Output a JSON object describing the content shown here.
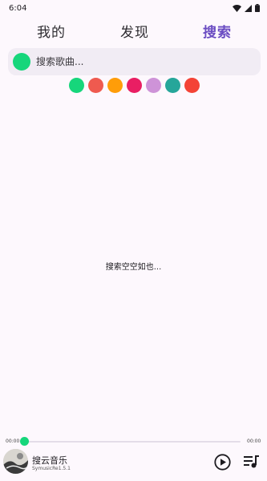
{
  "status": {
    "time": "6:04"
  },
  "tabs": [
    {
      "label": "我的"
    },
    {
      "label": "发现"
    },
    {
      "label": "搜索"
    }
  ],
  "search": {
    "placeholder": "搜索歌曲..."
  },
  "theme_colors": [
    "#16d67b",
    "#ef5a4f",
    "#ff9d09",
    "#e91e63",
    "#ce93d8",
    "#26a69a",
    "#f44336"
  ],
  "empty_message": "搜索空空如也...",
  "player": {
    "current_time": "00:00",
    "total_time": "00:00",
    "progress": 0,
    "title": "搜云音乐",
    "subtitle": "SymusicRe1.5.1",
    "accent": "#16d67b"
  },
  "icons": {
    "status": [
      "wifi-icon",
      "signal-icon",
      "battery-icon"
    ],
    "player": [
      "play-icon",
      "playlist-icon"
    ]
  }
}
